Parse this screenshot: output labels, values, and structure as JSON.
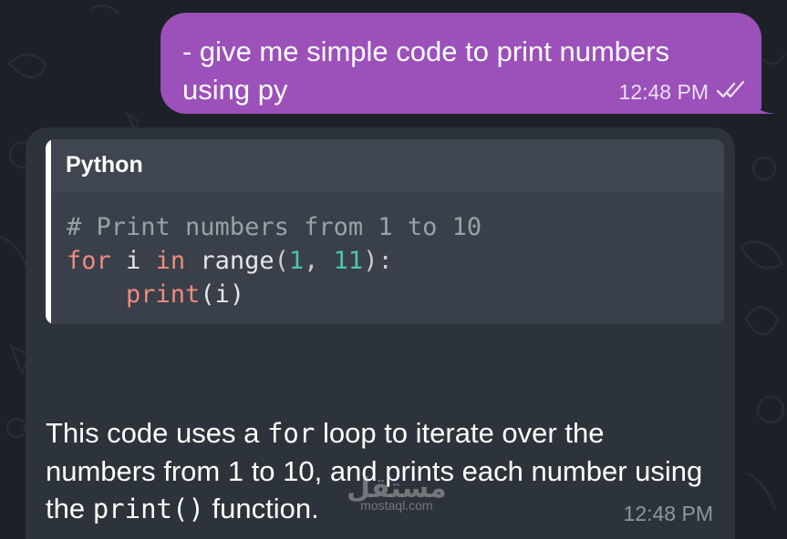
{
  "outgoing_message": {
    "text": "- give me simple code to print numbers using py",
    "time": "12:48 PM",
    "status_icon": "double-check-icon"
  },
  "incoming_message": {
    "code_block": {
      "language": "Python",
      "lines": {
        "comment": "# Print numbers from 1 to 10",
        "kw_for": "for",
        "var_i": " i ",
        "kw_in": "in",
        "fn_range": " range",
        "paren_open": "(",
        "num_1": "1",
        "comma": ", ",
        "num_11": "11",
        "paren_close_colon": "):",
        "indent": "    ",
        "fn_print": "print",
        "print_args": "(i)"
      }
    },
    "explanation": {
      "part1": "This code uses a ",
      "code1": "for",
      "part2": " loop to iterate over the numbers from 1 to 10, and prints each number using the ",
      "code2": "print()",
      "part3": " function."
    },
    "time": "12:48 PM"
  },
  "watermark": {
    "arabic": "مستقل",
    "latin": "mostaql.com"
  },
  "colors": {
    "background": "#1c2128",
    "outgoing_bubble": "#9b50ba",
    "incoming_bubble": "#2c333b",
    "code_bg": "#394049",
    "keyword": "#ef8a7f",
    "number": "#4fc3b4",
    "comment": "#9aa1a8"
  }
}
